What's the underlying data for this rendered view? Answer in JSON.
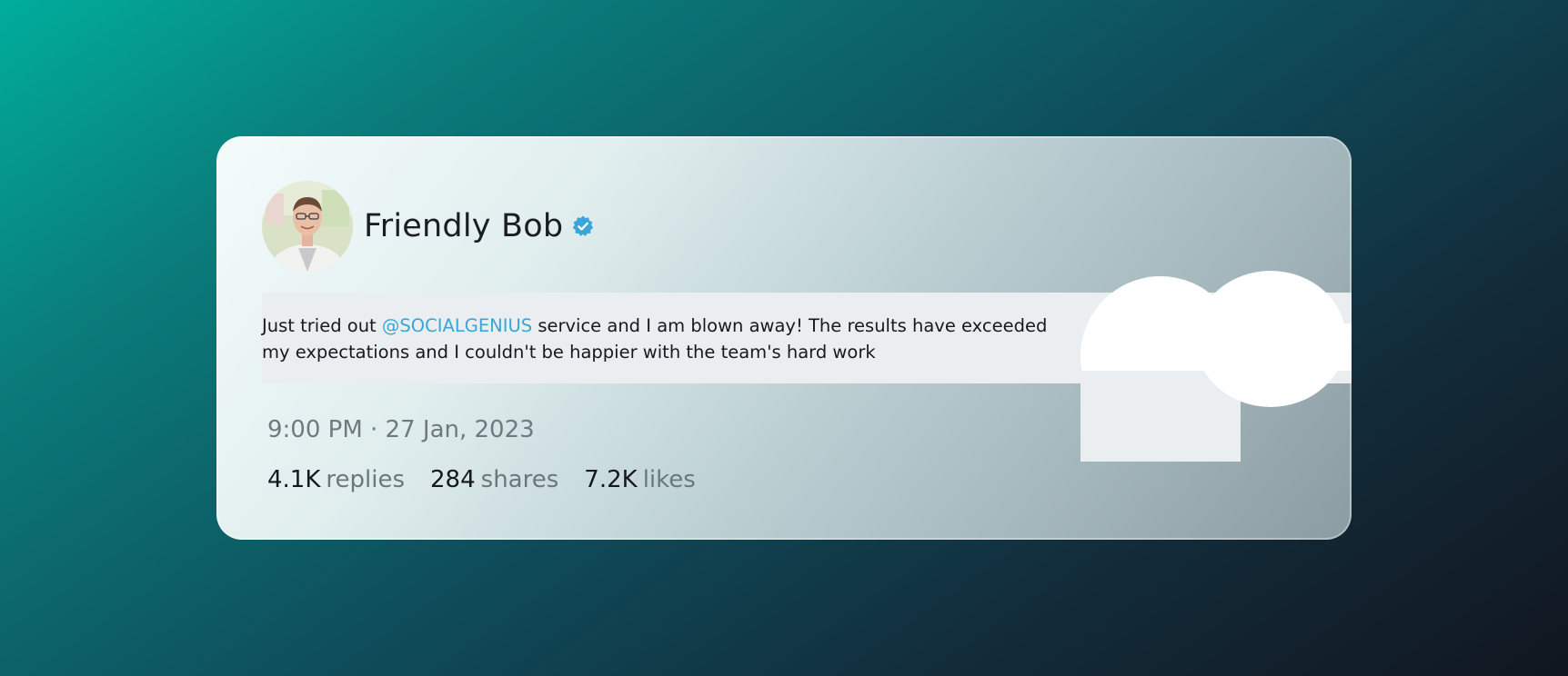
{
  "post": {
    "author_name": "Friendly Bob",
    "verified": true,
    "text_before_mention": "Just tried out ",
    "mention": "@SOCIALGENIUS",
    "text_after_mention": " service and I am blown away! The results have exceeded my expectations and I couldn't be happier with the team's hard work",
    "timestamp": "9:00 PM · 27 Jan, 2023"
  },
  "stats": {
    "replies_count": "4.1K",
    "replies_label": "replies",
    "shares_count": "284",
    "shares_label": "shares",
    "likes_count": "7.2K",
    "likes_label": "likes"
  },
  "icons": {
    "verified": "verified-badge-icon",
    "avatar": "profile-photo"
  },
  "colors": {
    "mention": "#3aa6d7",
    "verified": "#3aa6d7"
  }
}
